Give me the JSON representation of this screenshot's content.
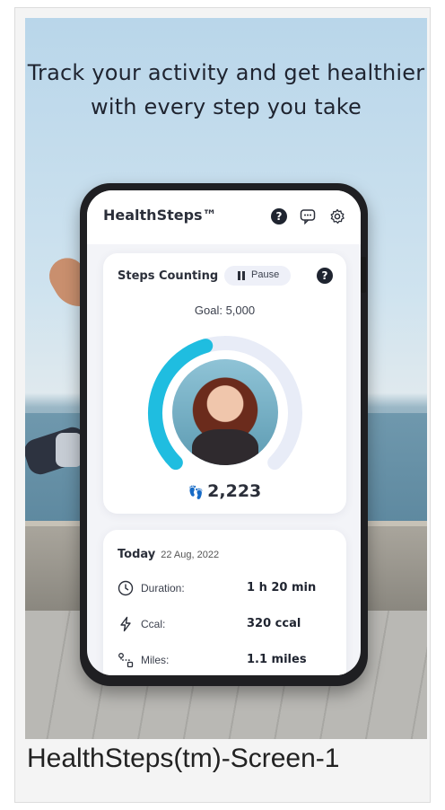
{
  "headline": "Track your activity and get healthier with every step you take",
  "caption": "HealthSteps(tm)-Screen-1",
  "app": {
    "title": "HealthSteps™",
    "header_icons": [
      "help-icon",
      "chat-icon",
      "settings-icon"
    ]
  },
  "steps_panel": {
    "title": "Steps Counting",
    "pause_label": "Pause",
    "goal": "Goal: 5,000",
    "goal_value": 5000,
    "steps": "2,223",
    "steps_value": 2223,
    "progress_fraction": 0.44
  },
  "today_panel": {
    "label": "Today",
    "date": "22 Aug, 2022",
    "stats": [
      {
        "icon": "clock-icon",
        "label": "Duration:",
        "value": "1 h 20 min"
      },
      {
        "icon": "lightning-icon",
        "label": "Ccal:",
        "value": "320 ccal"
      },
      {
        "icon": "route-icon",
        "label": "Miles:",
        "value": "1.1 miles"
      }
    ]
  },
  "colors": {
    "accent": "#1fbde0",
    "ring_track": "#e8ecf7",
    "text_dark": "#2b2f3a"
  }
}
